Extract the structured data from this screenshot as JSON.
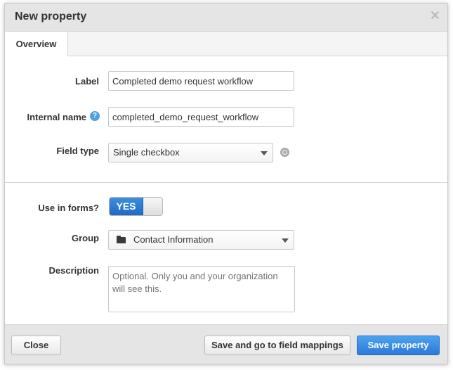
{
  "dialog": {
    "title": "New property",
    "close_glyph": "✕",
    "tabs": [
      {
        "label": "Overview",
        "active": true
      }
    ]
  },
  "form": {
    "label": {
      "label": "Label",
      "value": "Completed demo request workflow"
    },
    "internal_name": {
      "label": "Internal name",
      "value": "completed_demo_request_workflow",
      "help_glyph": "?"
    },
    "field_type": {
      "label": "Field type",
      "value": "Single checkbox",
      "icon": "camera-icon"
    },
    "use_in_forms": {
      "label": "Use in forms?",
      "value": "YES",
      "on": true
    },
    "group": {
      "label": "Group",
      "value": "Contact Information",
      "icon": "folder-icon"
    },
    "description": {
      "label": "Description",
      "placeholder": "Optional. Only you and your organization will see this.",
      "value": ""
    }
  },
  "footer": {
    "close_label": "Close",
    "save_mappings_label": "Save and go to field mappings",
    "save_label": "Save property"
  },
  "colors": {
    "primary": "#2b7ad9",
    "toggle_on": "#2f7fd6",
    "help_icon": "#4ea1e0"
  }
}
